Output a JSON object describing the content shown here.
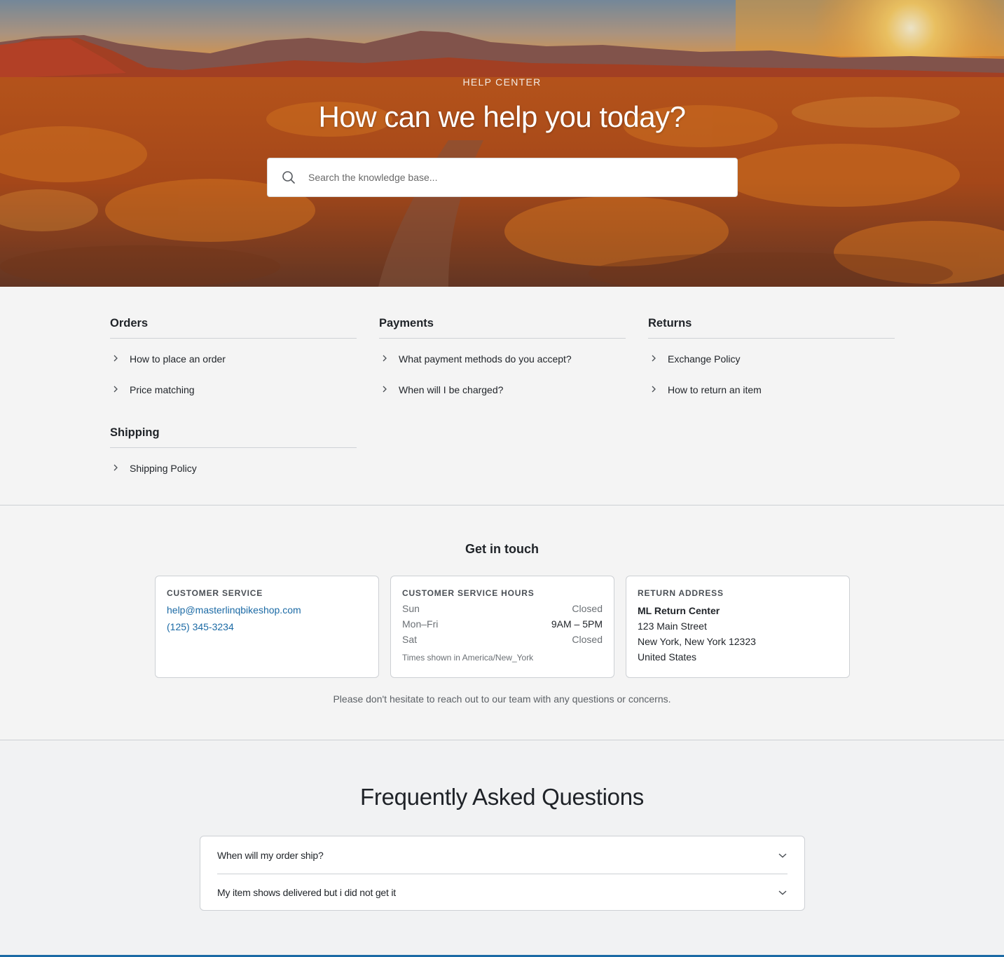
{
  "hero": {
    "eyebrow": "HELP CENTER",
    "title": "How can we help you today?",
    "search_placeholder": "Search the knowledge base...",
    "search_icon": "search-icon"
  },
  "categories": [
    {
      "title": "Orders",
      "links": [
        "How to place an order",
        "Price matching"
      ]
    },
    {
      "title": "Payments",
      "links": [
        "What payment methods do you accept?",
        "When will I be charged?"
      ]
    },
    {
      "title": "Returns",
      "links": [
        "Exchange Policy",
        "How to return an item"
      ]
    },
    {
      "title": "Shipping",
      "links": [
        "Shipping Policy"
      ]
    }
  ],
  "contact": {
    "title": "Get in touch",
    "customer_service": {
      "label": "CUSTOMER SERVICE",
      "email": "help@masterlinqbikeshop.com",
      "phone": "(125) 345-3234"
    },
    "hours": {
      "label": "CUSTOMER SERVICE HOURS",
      "rows": [
        {
          "day": "Sun",
          "time": "Closed"
        },
        {
          "day": "Mon–Fri",
          "time": "9AM – 5PM"
        },
        {
          "day": "Sat",
          "time": "Closed"
        }
      ],
      "timezone_note": "Times shown in America/New_York"
    },
    "return_address": {
      "label": "RETURN ADDRESS",
      "name": "ML Return Center",
      "street": "123 Main Street",
      "city_line": "New York, New York 12323",
      "country": "United States"
    },
    "note": "Please don't hesitate to reach out to our team with any questions or concerns."
  },
  "faq": {
    "title": "Frequently Asked Questions",
    "items": [
      "When will my order ship?",
      "My item shows delivered but i did not get it"
    ],
    "toggle_icon": "chevron-down-icon"
  },
  "colors": {
    "accent": "#1b6aa5",
    "text": "#1f2328",
    "muted": "#6b7075",
    "page_bg": "#f4f4f4"
  }
}
